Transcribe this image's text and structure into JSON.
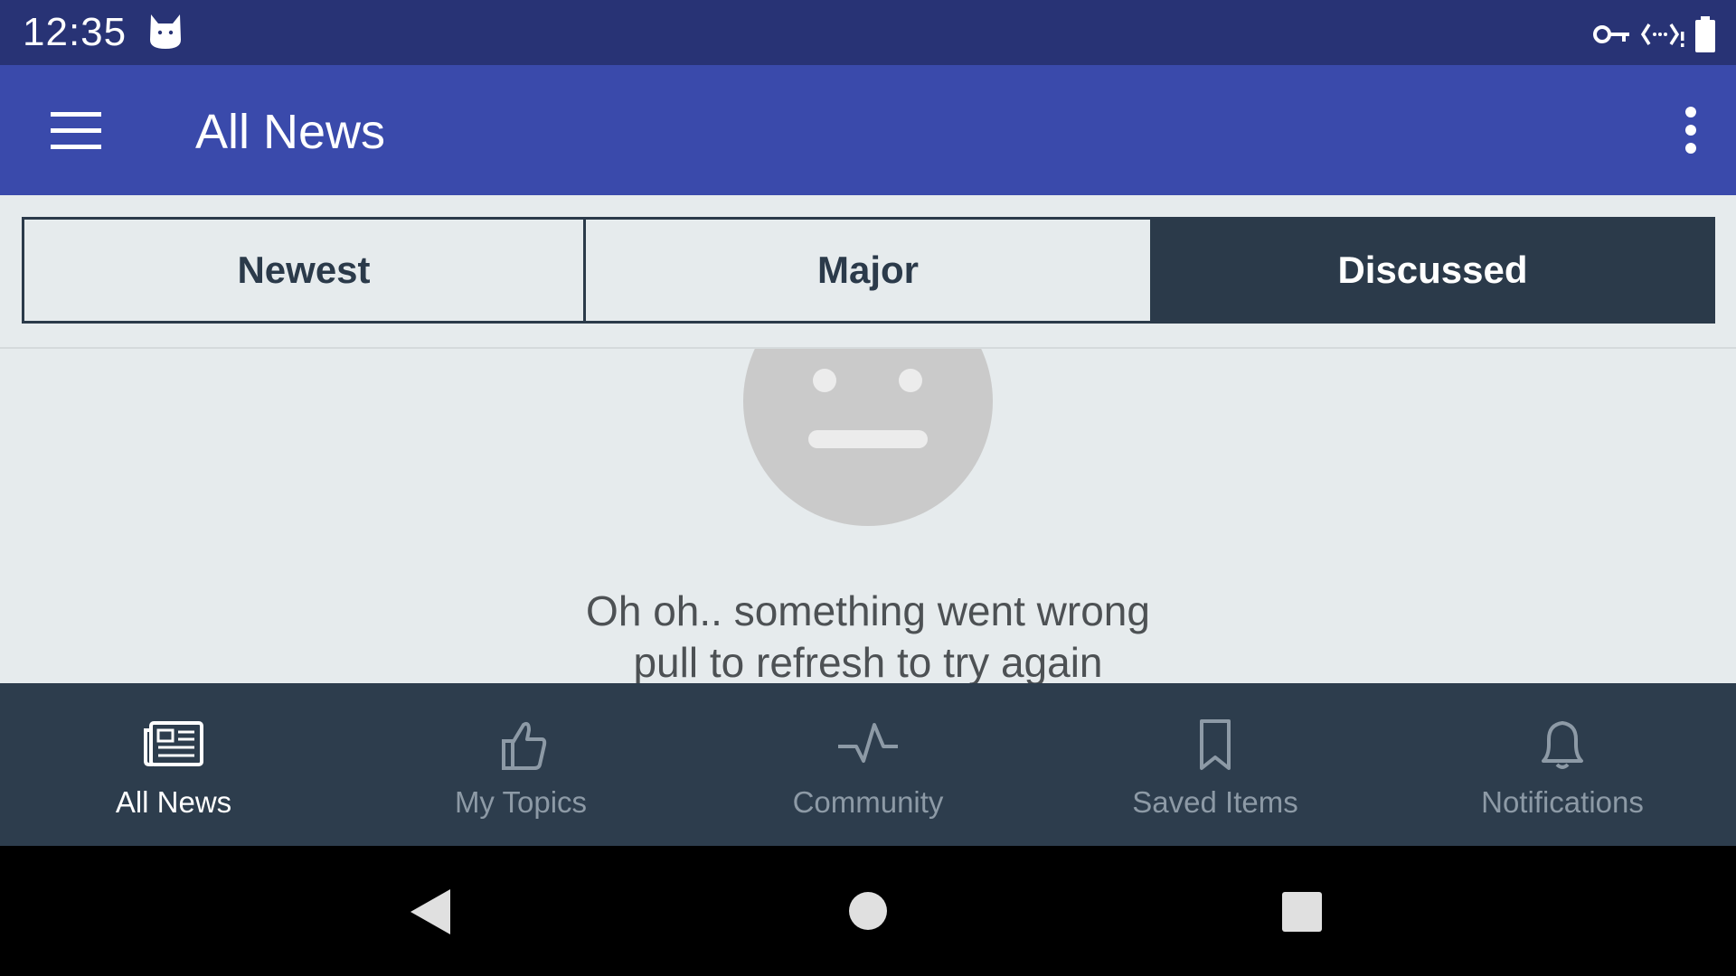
{
  "status_bar": {
    "time": "12:35",
    "icons": [
      "cat-notification-icon",
      "vpn-key-icon",
      "data-transfer-icon",
      "battery-icon"
    ]
  },
  "app_bar": {
    "title": "All News",
    "menu_icon": "hamburger-menu-icon",
    "overflow_icon": "more-vertical-icon"
  },
  "tabs": [
    {
      "label": "Newest",
      "selected": false
    },
    {
      "label": "Major",
      "selected": false
    },
    {
      "label": "Discussed",
      "selected": true
    }
  ],
  "error": {
    "icon": "neutral-face-icon",
    "line1": "Oh oh.. something went wrong",
    "line2": "pull to refresh to try again"
  },
  "bottom_nav": [
    {
      "label": "All News",
      "icon": "newspaper-icon",
      "active": true
    },
    {
      "label": "My Topics",
      "icon": "thumbs-up-icon",
      "active": false
    },
    {
      "label": "Community",
      "icon": "pulse-icon",
      "active": false
    },
    {
      "label": "Saved Items",
      "icon": "bookmark-icon",
      "active": false
    },
    {
      "label": "Notifications",
      "icon": "bell-icon",
      "active": false
    }
  ],
  "system_nav": [
    "back-icon",
    "home-icon",
    "recents-icon"
  ],
  "colors": {
    "status_bar": "#283375",
    "app_bar": "#3a4aab",
    "background": "#e6ebed",
    "segment_dark": "#2b3a4a",
    "bottom_nav": "#2d3d4d",
    "inactive_nav": "#8d9aa6"
  }
}
